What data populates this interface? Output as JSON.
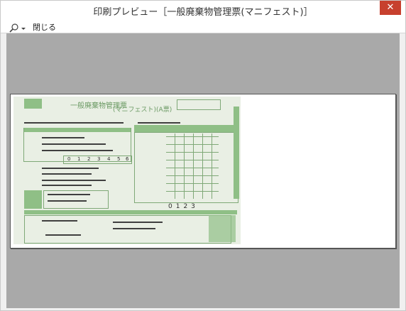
{
  "window": {
    "title": "印刷プレビュー［一般廃棄物管理票(マニフェスト)］",
    "close_glyph": "✕"
  },
  "toolbar": {
    "close_label": "閉じる"
  },
  "preview": {
    "form_title": "一般廃棄物管理票",
    "form_subtitle": "(マニフェスト)(A票)",
    "digits": [
      "0",
      "1",
      "2",
      "3",
      "4",
      "5",
      "6"
    ],
    "code": "0123"
  },
  "colors": {
    "form_green": "#8fbf86",
    "form_bg": "#e9efe4",
    "window_close": "#c7402e",
    "viewer_bg": "#a9a9a9"
  }
}
